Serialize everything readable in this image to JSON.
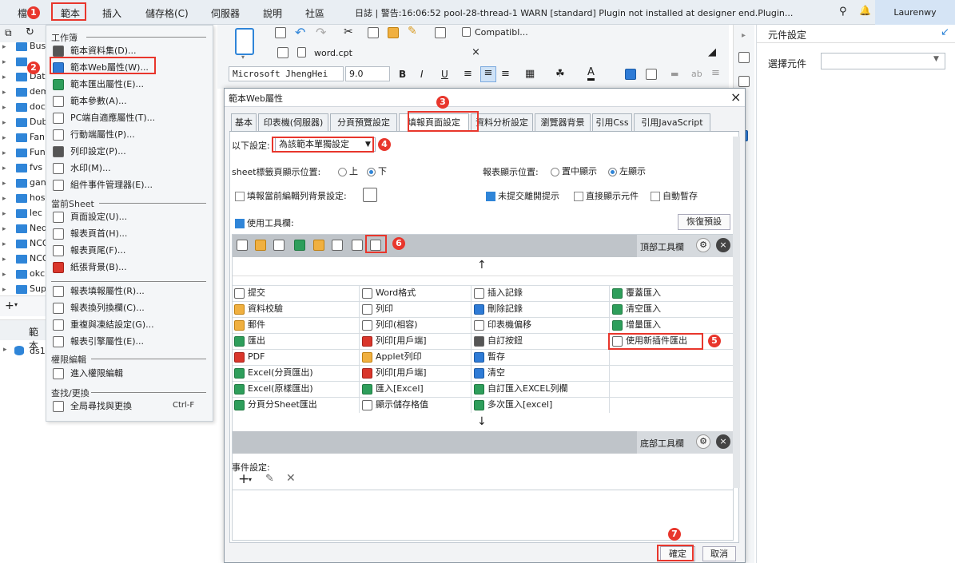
{
  "menubar": {
    "items": [
      "檔",
      "範本",
      "插入",
      "儲存格(C)",
      "伺服器",
      "說明",
      "社區"
    ],
    "log": "日誌 | 警告:16:06:52 pool-28-thread-1 WARN [standard] Plugin not installed at designer end.Plugin...",
    "user": "Laurenwy"
  },
  "tree": {
    "items": [
      "Bus",
      "",
      "Dat",
      "dem",
      "doc",
      "Dub",
      "Fan",
      "Fun",
      "fvs",
      "gan",
      "hos",
      "lec",
      "Ned",
      "NCO",
      "NCO",
      "okc",
      "Sup"
    ],
    "bottom_tab": "範本",
    "ds": "ds1"
  },
  "dropdown": {
    "section1": "工作簿",
    "section2": "當前Sheet",
    "section3": "權限編輯",
    "section4": "查找/更換",
    "items1": [
      "範本資料集(D)...",
      "範本Web屬性(W)...",
      "範本匯出屬性(E)...",
      "範本參數(A)...",
      "PC端自適應屬性(T)...",
      "行動端屬性(P)...",
      "列印設定(P)...",
      "水印(M)...",
      "組件事件管理器(E)..."
    ],
    "items2": [
      "頁面設定(U)...",
      "報表頁首(H)...",
      "報表頁尾(F)...",
      "紙張背景(B)..."
    ],
    "items3": [
      "報表填報屬性(R)...",
      "報表換列換欄(C)...",
      "重複與凍結設定(G)...",
      "報表引擎屬性(E)..."
    ],
    "items4": [
      "進入權限編輯"
    ],
    "items5": [
      "全局尋找與更換"
    ],
    "shortcut": "Ctrl-F"
  },
  "editor": {
    "compat": "Compatibl...",
    "file_tab": "word.cpt",
    "font": "Microsoft JhengHei",
    "font_size": "9.0"
  },
  "right_panel": {
    "title": "元件設定",
    "select_label": "選擇元件"
  },
  "dialog": {
    "title": "範本Web屬性",
    "tabs": [
      "基本",
      "印表機(伺服器)",
      "分頁預覽設定",
      "填報頁面設定",
      "資料分析設定",
      "瀏覽器背景",
      "引用Css",
      "引用JavaScript"
    ],
    "settings_label": "以下設定:",
    "settings_value": "為該範本單獨設定",
    "sheet_label": "sheet標籤頁顯示位置:",
    "opt_top": "上",
    "opt_bottom": "下",
    "report_pos_label": "報表顯示位置:",
    "opt_center": "置中顯示",
    "opt_left": "左顯示",
    "fill_bg": "填報當前編輯列背景設定:",
    "unsubmitted": "未提交離開提示",
    "direct_show": "直接顯示元件",
    "auto_save": "自動暫存",
    "use_toolbar": "使用工具欄:",
    "restore": "恢復預設",
    "top_toolbar": "頂部工具欄",
    "bottom_toolbar": "底部工具欄",
    "buttons": [
      [
        "提交",
        "Word格式",
        "插入記錄",
        "覆蓋匯入"
      ],
      [
        "資料校驗",
        "列印",
        "刪除記錄",
        "清空匯入"
      ],
      [
        "郵件",
        "列印(相容)",
        "印表機偏移",
        "增量匯入"
      ],
      [
        "匯出",
        "列印[用戶端]",
        "自訂按鈕",
        "使用新插件匯出"
      ],
      [
        "PDF",
        "Applet列印",
        "暫存",
        ""
      ],
      [
        "Excel(分頁匯出)",
        "列印[用戶端]",
        "清空",
        ""
      ],
      [
        "Excel(原樣匯出)",
        "匯入[Excel]",
        "自訂匯入EXCEL列欄",
        ""
      ],
      [
        "分頁分Sheet匯出",
        "顯示儲存格值",
        "多次匯入[excel]",
        ""
      ]
    ],
    "event_label": "事件設定:",
    "ok": "確定",
    "cancel": "取消"
  },
  "markers": [
    "1",
    "2",
    "3",
    "4",
    "5",
    "6",
    "7"
  ]
}
